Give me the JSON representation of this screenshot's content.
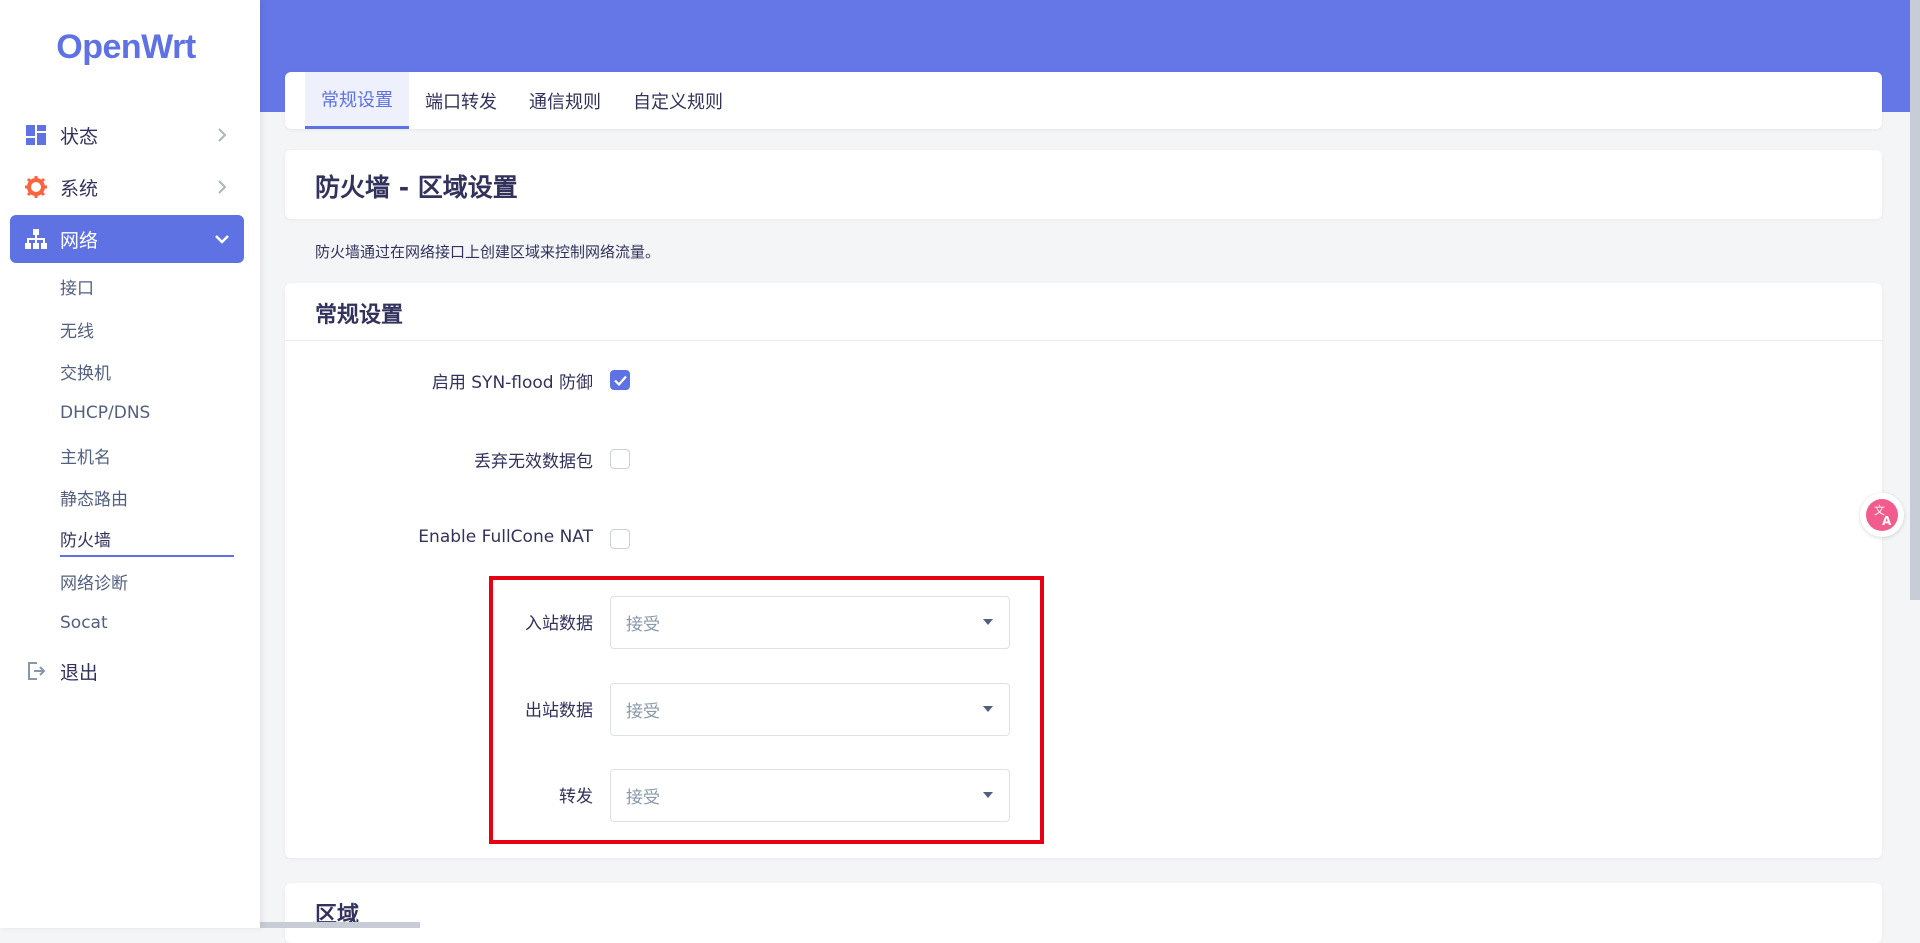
{
  "brand": {
    "logo": "OpenWrt"
  },
  "sidebar": {
    "items": [
      {
        "label": "状态",
        "icon": "dashboard-icon"
      },
      {
        "label": "系统",
        "icon": "gear-icon"
      },
      {
        "label": "网络",
        "icon": "network-icon",
        "expanded": true
      },
      {
        "label": "退出",
        "icon": "logout-icon"
      }
    ],
    "submenu": [
      "接口",
      "无线",
      "交换机",
      "DHCP/DNS",
      "主机名",
      "静态路由",
      "防火墙",
      "网络诊断",
      "Socat"
    ],
    "current_submenu": "防火墙"
  },
  "tabs": [
    "常规设置",
    "端口转发",
    "通信规则",
    "自定义规则"
  ],
  "active_tab": "常规设置",
  "page": {
    "title": "防火墙 - 区域设置",
    "description": "防火墙通过在网络接口上创建区域来控制网络流量。"
  },
  "general": {
    "section_title": "常规设置",
    "syn_flood_label": "启用 SYN-flood 防御",
    "syn_flood_checked": true,
    "drop_invalid_label": "丢弃无效数据包",
    "drop_invalid_checked": false,
    "fullcone_label": "Enable FullCone NAT",
    "fullcone_checked": false,
    "input_label": "入站数据",
    "input_value": "接受",
    "output_label": "出站数据",
    "output_value": "接受",
    "forward_label": "转发",
    "forward_value": "接受"
  },
  "zones": {
    "section_title": "区域"
  },
  "colors": {
    "accent": "#5e72e4",
    "banner": "#6577e6",
    "highlight": "#e60012",
    "system_icon": "#fb6340"
  }
}
